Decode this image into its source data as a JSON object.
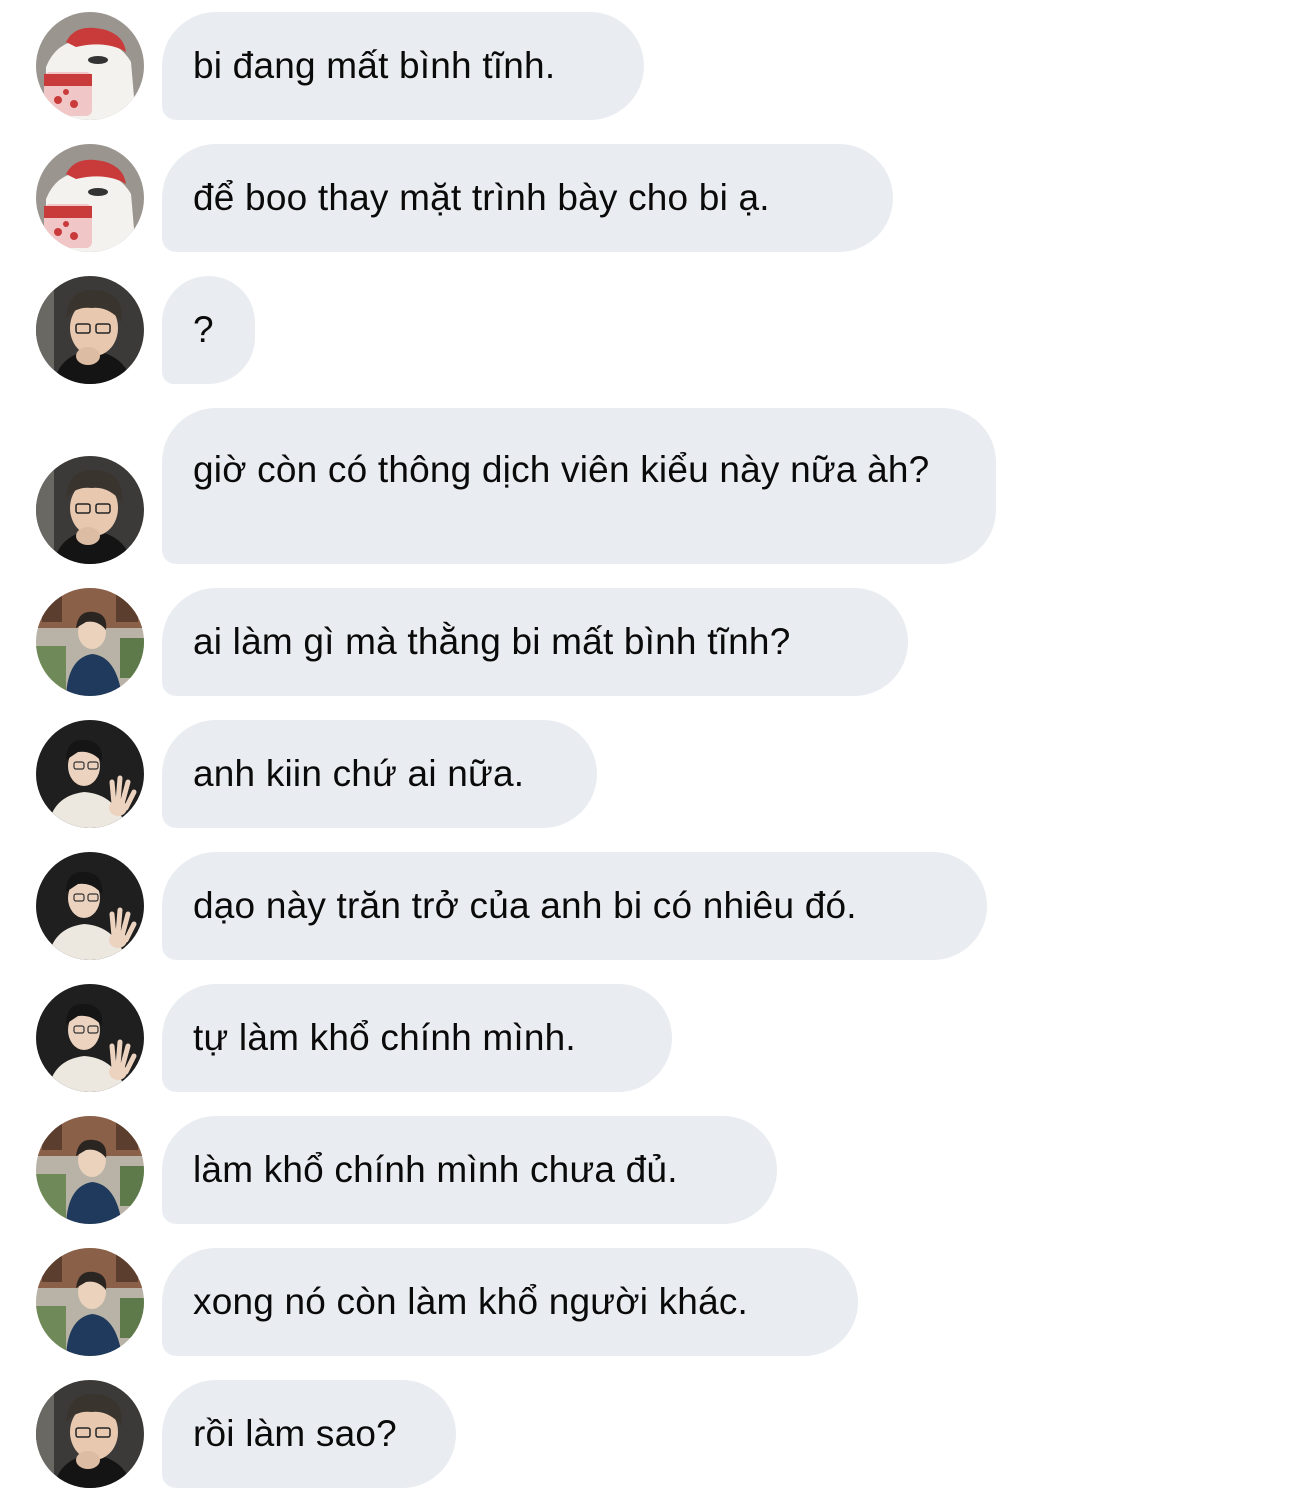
{
  "messages": [
    {
      "sender": "bear",
      "text": "bi đang mất bình tĩnh."
    },
    {
      "sender": "bear",
      "text": "để boo thay mặt trình bày cho bi ạ."
    },
    {
      "sender": "glasses",
      "text": "?"
    },
    {
      "sender": "glasses",
      "text": "giờ còn có thông dịch viên kiểu này nữa àh?"
    },
    {
      "sender": "street",
      "text": "ai làm gì mà thằng bi mất bình tĩnh?"
    },
    {
      "sender": "waving",
      "text": "anh kiin chứ ai nữa."
    },
    {
      "sender": "waving",
      "text": "dạo này trăn trở của anh bi có nhiêu đó."
    },
    {
      "sender": "waving",
      "text": "tự làm khổ chính mình."
    },
    {
      "sender": "street",
      "text": "làm khổ chính mình chưa đủ."
    },
    {
      "sender": "street",
      "text": "xong nó còn làm khổ người khác."
    },
    {
      "sender": "glasses",
      "text": "rồi làm sao?"
    }
  ],
  "colors": {
    "bubble": "#e9ecf0",
    "text": "#0a0a0a",
    "background": "#ffffff"
  }
}
